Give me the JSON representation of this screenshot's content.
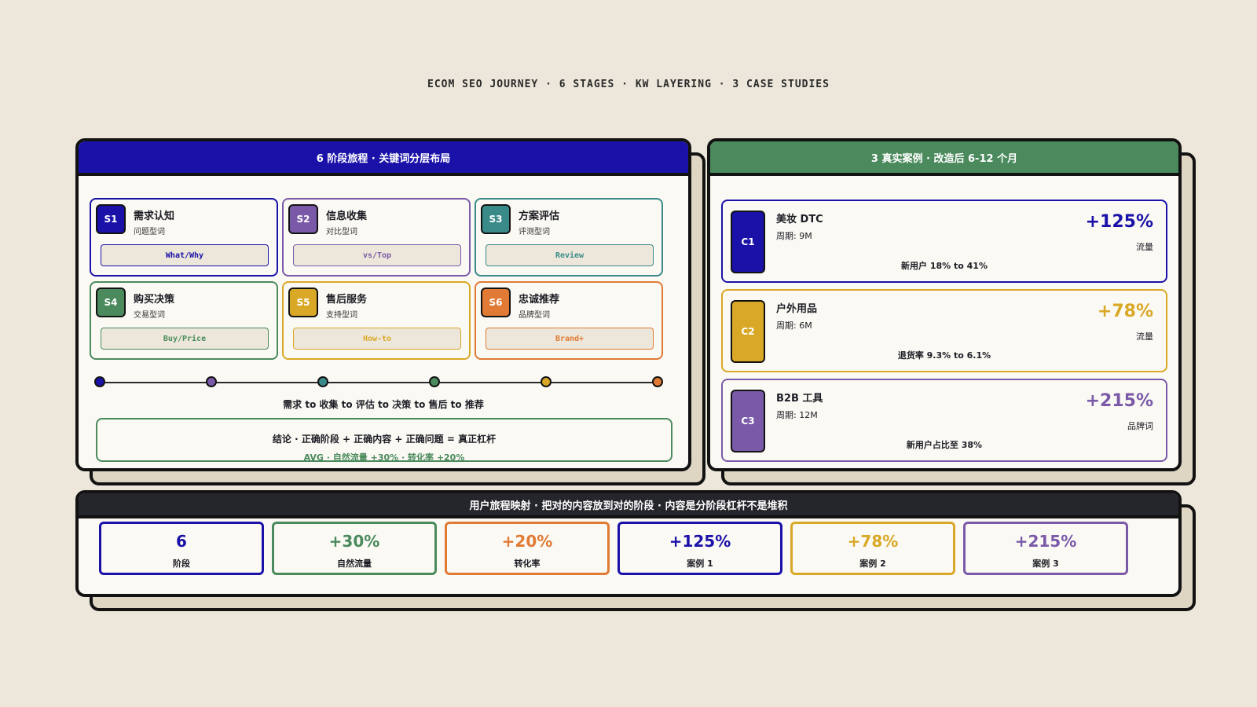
{
  "caption": "ECOM SEO JOURNEY · 6 STAGES · KW LAYERING · 3 CASE STUDIES",
  "colors": {
    "navy": "#1a11a8",
    "purple": "#7a5aa8",
    "teal": "#3a8a8a",
    "green": "#4a8a5c",
    "gold": "#d9a826",
    "orange": "#e07a34",
    "dark": "#25252c"
  },
  "journey": {
    "header": "6 阶段旅程 · 关键词分层布局",
    "stages": [
      {
        "code": "S1",
        "name": "需求认知",
        "sub": "问题型词",
        "kw": "What/Why"
      },
      {
        "code": "S2",
        "name": "信息收集",
        "sub": "对比型词",
        "kw": "vs/Top"
      },
      {
        "code": "S3",
        "name": "方案评估",
        "sub": "评测型词",
        "kw": "Review"
      },
      {
        "code": "S4",
        "name": "购买决策",
        "sub": "交易型词",
        "kw": "Buy/Price"
      },
      {
        "code": "S5",
        "name": "售后服务",
        "sub": "支持型词",
        "kw": "How-to"
      },
      {
        "code": "S6",
        "name": "忠诚推荐",
        "sub": "品牌型词",
        "kw": "Brand+"
      }
    ],
    "flow": "需求 to 收集 to 评估 to 决策 to 售后 to 推荐",
    "conclusion": "结论 · 正确阶段 + 正确内容 + 正确问题 = 真正杠杆",
    "conclusion_sub": "AVG · 自然流量 +30% · 转化率 +20%"
  },
  "cases": {
    "header": "3 真实案例 · 改造后 6-12 个月",
    "items": [
      {
        "code": "C1",
        "name": "美妆 DTC",
        "period": "周期: 9M",
        "detail": "新用户 18% to 41%",
        "value": "+125%",
        "metric": "流量"
      },
      {
        "code": "C2",
        "name": "户外用品",
        "period": "周期: 6M",
        "detail": "退货率 9.3% to 6.1%",
        "value": "+78%",
        "metric": "流量"
      },
      {
        "code": "C3",
        "name": "B2B 工具",
        "period": "周期: 12M",
        "detail": "新用户占比至 38%",
        "value": "+215%",
        "metric": "品牌词"
      }
    ]
  },
  "summary": {
    "header": "用户旅程映射 · 把对的内容放到对的阶段 · 内容是分阶段杠杆不是堆积",
    "stats": [
      {
        "value": "6",
        "label": "阶段"
      },
      {
        "value": "+30%",
        "label": "自然流量"
      },
      {
        "value": "+20%",
        "label": "转化率"
      },
      {
        "value": "+125%",
        "label": "案例 1"
      },
      {
        "value": "+78%",
        "label": "案例 2"
      },
      {
        "value": "+215%",
        "label": "案例 3"
      }
    ]
  }
}
